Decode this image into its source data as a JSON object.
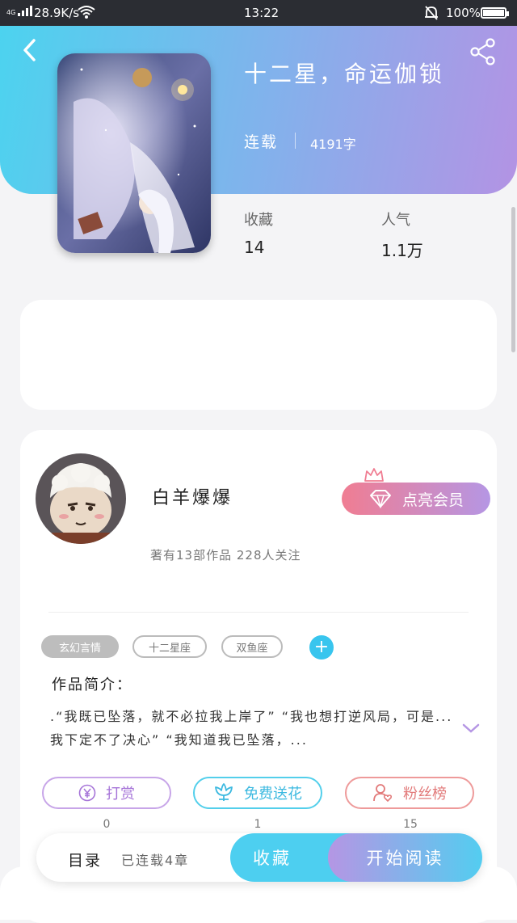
{
  "status_bar": {
    "network": "4G",
    "speed": "28.9K/s",
    "time": "13:22",
    "battery": "100%"
  },
  "book": {
    "title": "十二星，命运伽锁",
    "status": "连载",
    "word_count": "4191字",
    "stats": [
      {
        "label": "收藏",
        "value": "14"
      },
      {
        "label": "人气",
        "value": "1.1万"
      }
    ]
  },
  "author": {
    "name": "白羊爆爆",
    "meta": "著有13部作品 228人关注",
    "vip_label": "点亮会员"
  },
  "tags": [
    "玄幻言情",
    "十二星座",
    "双鱼座"
  ],
  "intro": {
    "label": "作品简介：",
    "text": ".“我既已坠落，就不必拉我上岸了” “我也想打逆风局，可是...我下定不了决心” “我知道我已坠落，..."
  },
  "actions": [
    {
      "label": "打赏",
      "icon": "yen-icon",
      "count": "0"
    },
    {
      "label": "免费送花",
      "icon": "flower-icon",
      "count": "1"
    },
    {
      "label": "粉丝榜",
      "icon": "user-heart-icon",
      "count": "15"
    }
  ],
  "bottom": {
    "toc_label": "目录",
    "chapters": "已连载4章",
    "collect_label": "收藏",
    "read_label": "开始阅读"
  },
  "colors": {
    "header_start": "#4cd3ef",
    "header_end": "#b393e4",
    "accent_cyan": "#4dcff0",
    "accent_purple": "#b596e4",
    "vip_pink": "#f07d92"
  }
}
